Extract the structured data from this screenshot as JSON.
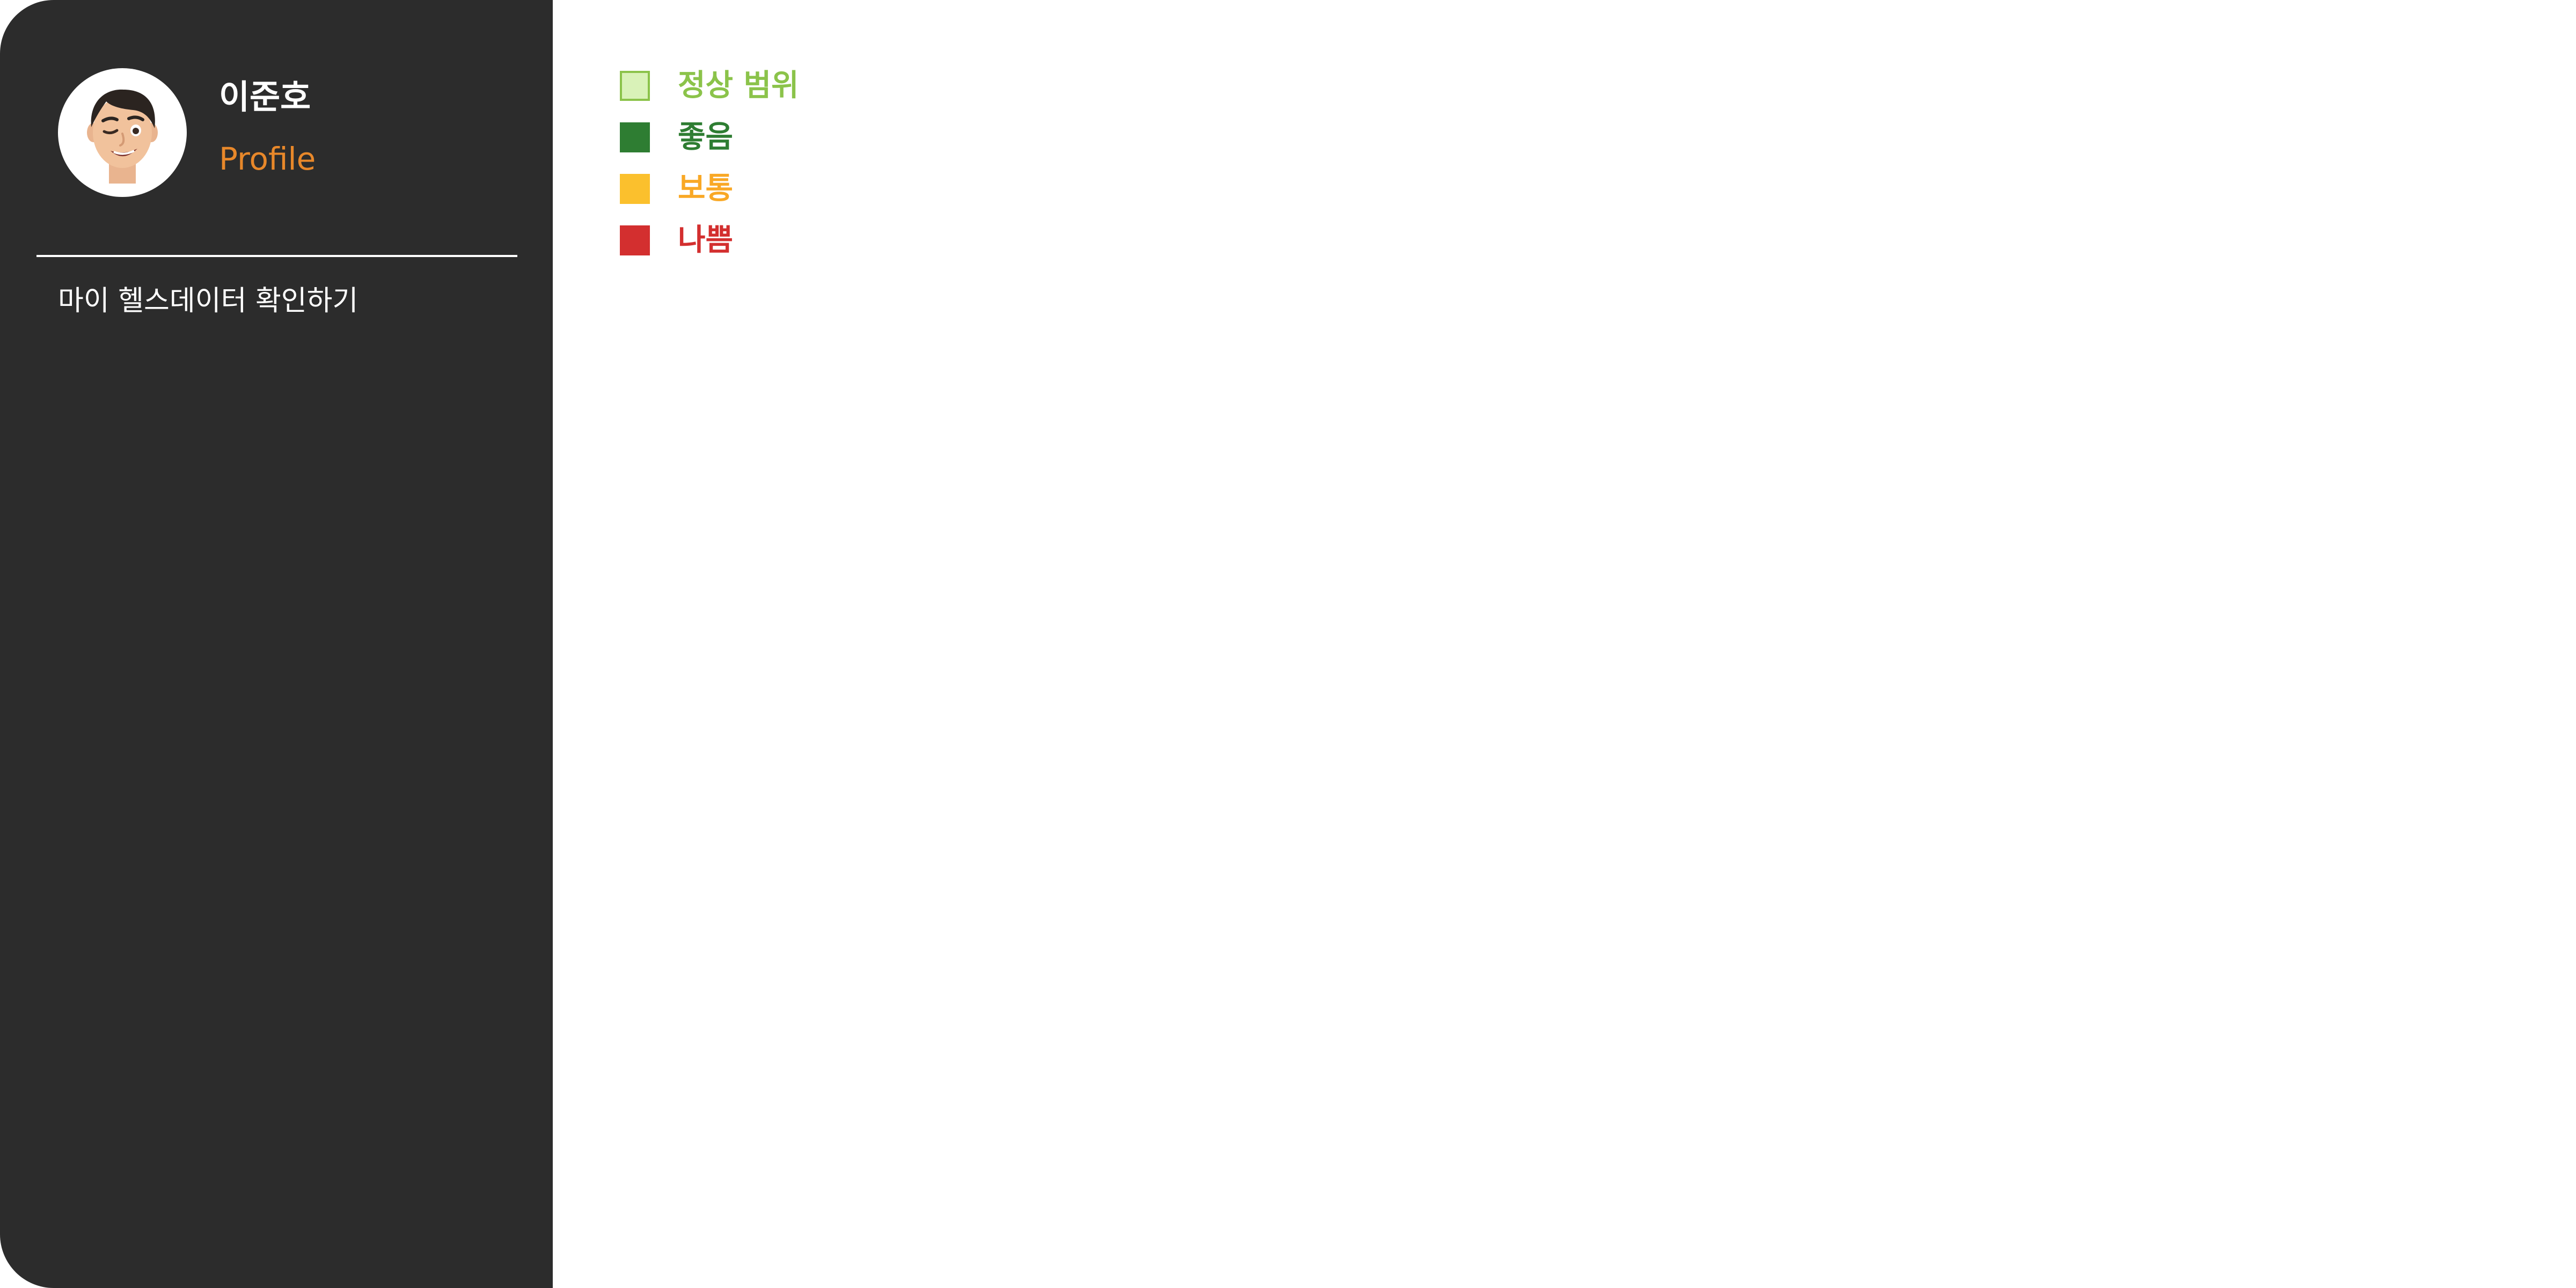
{
  "profile": {
    "name": "이준호",
    "role": "Profile",
    "avatar_icon": "memoji-avatar-icon"
  },
  "sidebar": {
    "nav_link": "마이 헬스데이터  확인하기"
  },
  "legend": {
    "items": [
      {
        "label": "정상 범위",
        "swatch_fill": "#d9f2b8",
        "swatch_border": "#8bc34a",
        "text_color": "#8bc34a"
      },
      {
        "label": "좋음",
        "swatch_fill": "#2e7d32",
        "swatch_border": "#2e7d32",
        "text_color": "#2e7d32"
      },
      {
        "label": "보통",
        "swatch_fill": "#fbc02d",
        "swatch_border": "#fbc02d",
        "text_color": "#f9a825"
      },
      {
        "label": "나쁨",
        "swatch_fill": "#d32f2f",
        "swatch_border": "#d32f2f",
        "text_color": "#d32f2f"
      }
    ]
  },
  "colors": {
    "sidebar_bg": "#2c2c2c",
    "accent": "#e8882a",
    "page_bg": "#ffffff"
  }
}
